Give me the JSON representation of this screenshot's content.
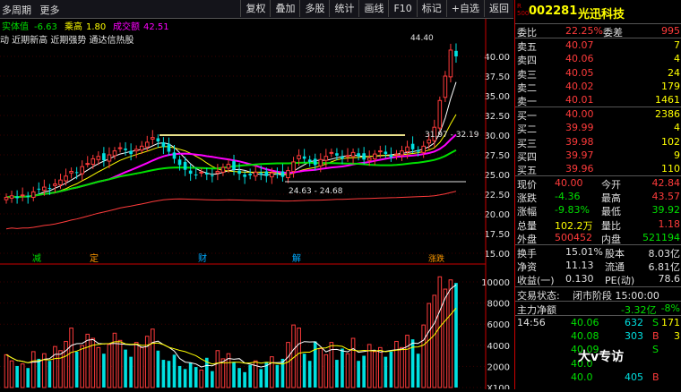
{
  "toolbar": {
    "period": "多周期",
    "more": "更多",
    "buttons": [
      "复权",
      "叠加",
      "多股",
      "统计",
      "画线",
      "F10",
      "标记",
      "+自选",
      "返回"
    ]
  },
  "chart_top": {
    "indicators": [
      {
        "label": "实体值",
        "value": "-6.63",
        "color": "#00e000"
      },
      {
        "label": "乘高",
        "value": "1.80",
        "color": "#ffff00"
      },
      {
        "label": "成交额",
        "value": "42.51",
        "color": "#ff00ff"
      }
    ],
    "concept_line": "动 近期新高 近期强势 通达信热股",
    "high_label": "44.40",
    "low_label": "24.63 - 24.68",
    "range_label": "31.97 - 32.19",
    "event_tags": [
      "减",
      "定",
      "财",
      "解",
      "涨跌"
    ]
  },
  "chart_data": {
    "type": "candlestick",
    "price_axis": [
      "40.00",
      "37.50",
      "35.00",
      "32.50",
      "30.00",
      "27.50",
      "25.00",
      "22.50",
      "20.00",
      "17.50",
      "15.00"
    ],
    "price_range": [
      15.0,
      42.5
    ],
    "volume_axis": [
      "10000",
      "8000",
      "6000",
      "4000",
      "2000",
      "X100"
    ],
    "volume_range": [
      0,
      11000
    ],
    "closes": [
      22.1,
      22.3,
      22.0,
      22.4,
      22.2,
      22.8,
      23.1,
      23.4,
      23.2,
      23.8,
      24.3,
      24.8,
      25.4,
      25.2,
      26.0,
      26.4,
      27.0,
      27.3,
      26.8,
      27.5,
      28.0,
      28.4,
      28.1,
      27.6,
      28.2,
      28.6,
      29.1,
      29.7,
      29.2,
      28.5,
      27.9,
      27.0,
      26.2,
      25.6,
      25.1,
      24.9,
      25.3,
      25.0,
      24.8,
      25.4,
      25.9,
      26.3,
      25.6,
      25.1,
      24.7,
      24.9,
      25.3,
      25.0,
      24.8,
      25.2,
      25.0,
      24.7,
      25.5,
      26.6,
      27.4,
      27.0,
      26.6,
      26.2,
      26.9,
      27.3,
      27.8,
      27.4,
      27.0,
      27.4,
      27.8,
      27.3,
      26.9,
      27.1,
      27.6,
      28.0,
      27.6,
      27.2,
      27.6,
      28.0,
      28.5,
      28.2,
      27.9,
      28.6,
      29.4,
      31.0,
      34.4,
      37.5,
      40.8,
      40.0
    ],
    "volumes": [
      3200,
      2600,
      2100,
      2300,
      1900,
      3500,
      2800,
      3300,
      2600,
      4000,
      3600,
      4500,
      5800,
      3500,
      4100,
      5200,
      4800,
      3900,
      3300,
      4200,
      5300,
      4600,
      3700,
      3000,
      4400,
      3900,
      5000,
      5700,
      3600,
      2700,
      2600,
      3200,
      2100,
      1800,
      2400,
      2000,
      1700,
      2900,
      1600,
      3600,
      2800,
      3300,
      2500,
      1900,
      1500,
      2200,
      2600,
      1800,
      2500,
      3000,
      2200,
      2800,
      4400,
      6100,
      5800,
      3300,
      2600,
      4500,
      3800,
      3200,
      4400,
      2700,
      3800,
      3300,
      4800,
      2600,
      3100,
      4200,
      3500,
      3900,
      3000,
      3500,
      4500,
      3900,
      5100,
      4700,
      3300,
      6100,
      8200,
      9000,
      10800,
      9600,
      10500,
      10200
    ],
    "ma_colors": [
      "#ffffff",
      "#ffff00",
      "#ff00ff",
      "#00e000",
      "#ff3b3b"
    ]
  },
  "quote": {
    "badge_top": "R",
    "badge_bottom": "500",
    "code": "002281",
    "name": "光迅科技",
    "weibi_label": "委比",
    "weibi_value": "22.25%",
    "weicha_label": "委差",
    "weicha_value": "995",
    "asks": [
      {
        "label": "卖五",
        "price": "40.07",
        "vol": "7"
      },
      {
        "label": "卖四",
        "price": "40.06",
        "vol": "4"
      },
      {
        "label": "卖三",
        "price": "40.05",
        "vol": "24"
      },
      {
        "label": "卖二",
        "price": "40.02",
        "vol": "179"
      },
      {
        "label": "卖一",
        "price": "40.01",
        "vol": "1461"
      }
    ],
    "bids": [
      {
        "label": "买一",
        "price": "40.00",
        "vol": "2386"
      },
      {
        "label": "买二",
        "price": "39.99",
        "vol": "4"
      },
      {
        "label": "买三",
        "price": "39.98",
        "vol": "102"
      },
      {
        "label": "买四",
        "price": "39.97",
        "vol": "9"
      },
      {
        "label": "买五",
        "price": "39.96",
        "vol": "110"
      }
    ],
    "stats": [
      {
        "l1": "现价",
        "v1": "40.00",
        "c1": "red",
        "l2": "今开",
        "v2": "42.84",
        "c2": "red"
      },
      {
        "l1": "涨跌",
        "v1": "-4.36",
        "c1": "green",
        "l2": "最高",
        "v2": "43.57",
        "c2": "red"
      },
      {
        "l1": "涨幅",
        "v1": "-9.83%",
        "c1": "green",
        "l2": "最低",
        "v2": "39.92",
        "c2": "green"
      },
      {
        "l1": "总量",
        "v1": "102.2万",
        "c1": "yellow",
        "l2": "量比",
        "v2": "1.18",
        "c2": "red"
      },
      {
        "l1": "外盘",
        "v1": "500452",
        "c1": "red",
        "l2": "内盘",
        "v2": "521194",
        "c2": "green"
      }
    ],
    "fund": [
      {
        "l1": "换手",
        "v1": "15.01%",
        "l2": "股本",
        "v2": "8.03亿"
      },
      {
        "l1": "净资",
        "v1": "11.13",
        "l2": "流通",
        "v2": "6.81亿"
      },
      {
        "l1": "收益(一)",
        "v1": "0.130",
        "l2": "PE(动)",
        "v2": "78.6"
      }
    ],
    "trade_status_label": "交易状态:",
    "trade_status_value": "闭市阶段 15:00:00",
    "main_flow_label": "主力净额",
    "main_flow_value": "-3.32亿",
    "main_flow_pct": "-8%",
    "ticks": [
      {
        "time": "14:56",
        "price": "40.06",
        "vol": "632",
        "side": "S",
        "extra": "171"
      },
      {
        "time": "",
        "price": "40.08",
        "vol": "303",
        "side": "B",
        "extra": "3"
      },
      {
        "time": "",
        "price": "40.09",
        "vol": "",
        "side": "S",
        "extra": ""
      },
      {
        "time": "",
        "price": "40.0",
        "vol": "",
        "side": "",
        "extra": ""
      },
      {
        "time": "",
        "price": "40.0",
        "vol": "405",
        "side": "B",
        "extra": ""
      }
    ]
  },
  "watermark": "大v专访"
}
